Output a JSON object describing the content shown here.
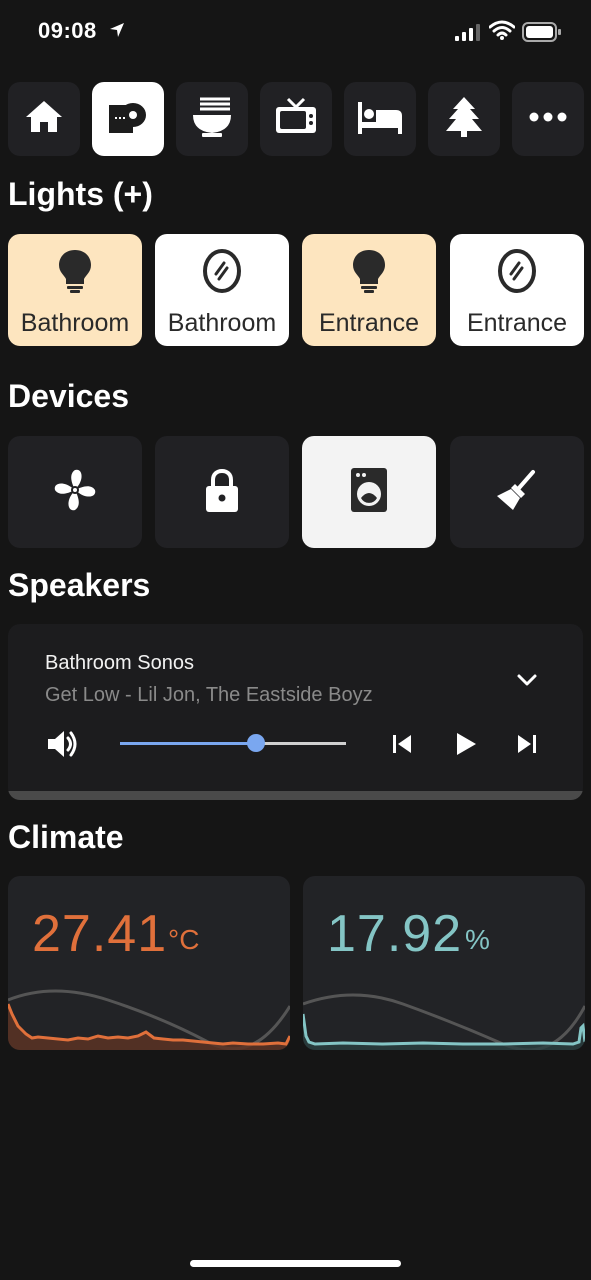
{
  "status": {
    "time": "09:08"
  },
  "nav": {
    "tabs": [
      {
        "icon": "home-icon",
        "active": false
      },
      {
        "icon": "toilet-paper-icon",
        "active": true
      },
      {
        "icon": "noodle-bowl-icon",
        "active": false
      },
      {
        "icon": "tv-icon",
        "active": false
      },
      {
        "icon": "bed-icon",
        "active": false
      },
      {
        "icon": "pine-tree-icon",
        "active": false
      },
      {
        "icon": "more-dots-icon",
        "active": false
      }
    ]
  },
  "lights": {
    "title": "Lights (+)",
    "items": [
      {
        "label": "Bathroom",
        "icon": "lightbulb-icon",
        "state": "on"
      },
      {
        "label": "Bathroom",
        "icon": "mirror-icon",
        "state": "off"
      },
      {
        "label": "Entrance",
        "icon": "lightbulb-icon",
        "state": "on"
      },
      {
        "label": "Entrance",
        "icon": "mirror-icon",
        "state": "off"
      }
    ]
  },
  "devices": {
    "title": "Devices",
    "items": [
      {
        "icon": "fan-icon",
        "state": "off"
      },
      {
        "icon": "lock-icon",
        "state": "off"
      },
      {
        "icon": "washing-machine-icon",
        "state": "on"
      },
      {
        "icon": "broom-icon",
        "state": "off"
      }
    ]
  },
  "speakers": {
    "title": "Speakers",
    "name": "Bathroom Sonos",
    "track": "Get Low - Lil Jon, The Eastside Boyz",
    "volume": 0.6
  },
  "climate": {
    "title": "Climate",
    "temperature": {
      "value": "27.41",
      "unit": "°C",
      "color": "#e0703b"
    },
    "humidity": {
      "value": "17.92",
      "unit": "%",
      "color": "#84c5c5"
    }
  },
  "colors": {
    "accent": "#7aa7f0",
    "light_on": "#fde5bf",
    "tile": "#212124"
  }
}
